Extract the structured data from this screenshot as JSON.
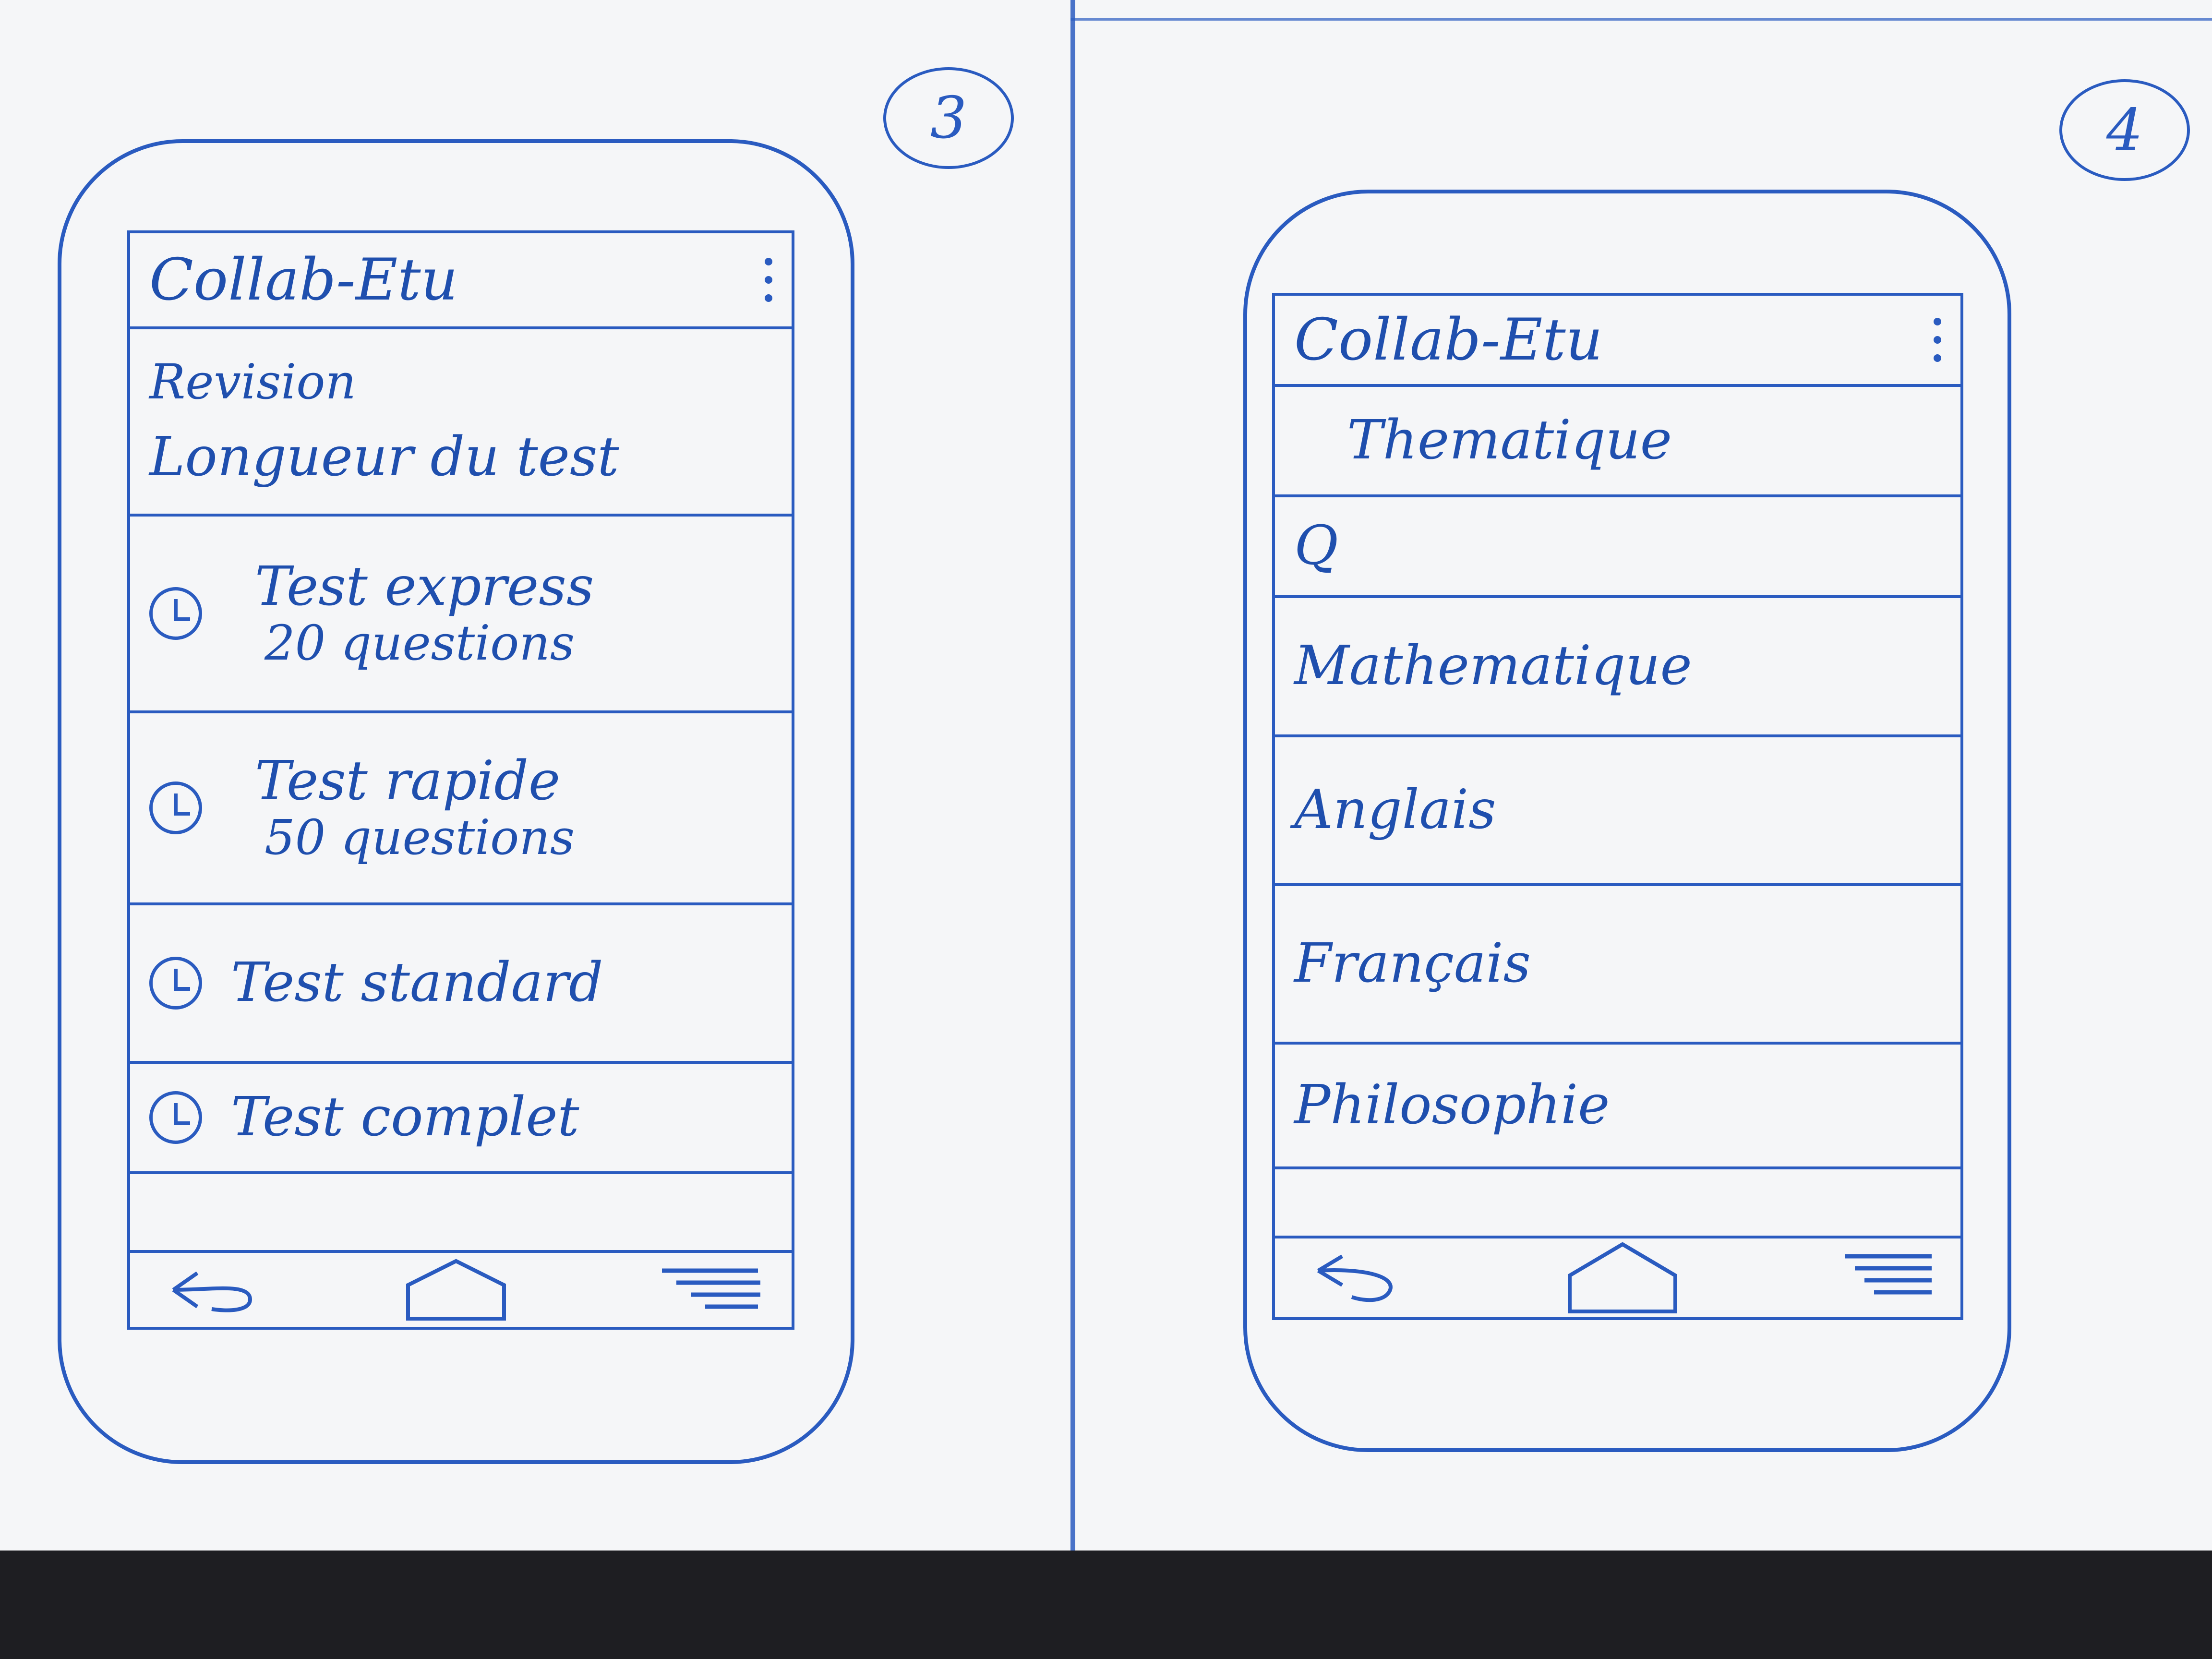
{
  "screen3": {
    "page_number": "3",
    "app_title": "Collab-Etu",
    "header_line1": "Revision",
    "header_line2": "Longueur du test",
    "options": [
      {
        "title": "Test express",
        "subtitle": "20 questions"
      },
      {
        "title": "Test rapide",
        "subtitle": "50 questions"
      },
      {
        "title": "Test standard",
        "subtitle": ""
      },
      {
        "title": "Test complet",
        "subtitle": ""
      }
    ]
  },
  "screen4": {
    "page_number": "4",
    "app_title": "Collab-Etu",
    "section_title": "Thematique",
    "search_label": "Q",
    "subjects": [
      "Mathematique",
      "Anglais",
      "Français",
      "Philosophie"
    ]
  },
  "icons": {
    "menu": "more-vert-icon",
    "back": "back-arrow-icon",
    "home": "home-icon",
    "recent": "menu-lines-icon",
    "clock": "clock-icon",
    "search": "search-icon"
  },
  "colors": {
    "ink": "#2a5bc0",
    "paper": "#f5f6f8"
  }
}
